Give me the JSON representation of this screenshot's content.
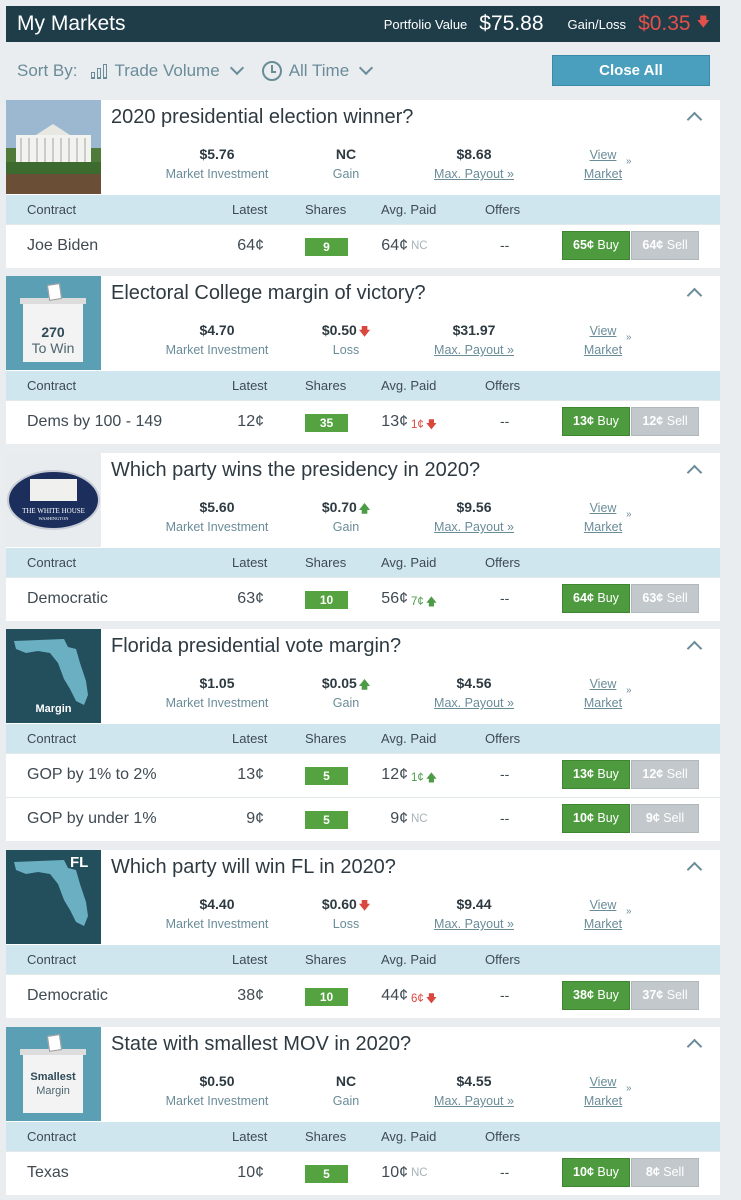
{
  "header": {
    "title": "My Markets",
    "portfolio_label": "Portfolio Value",
    "portfolio_value": "$75.88",
    "gainloss_label": "Gain/Loss",
    "gainloss_value": "$0.35",
    "gainloss_arrow": "down-arrow-icon"
  },
  "sortbar": {
    "label": "Sort By:",
    "sort_option": "Trade Volume",
    "time_option": "All Time",
    "close_all": "Close All"
  },
  "table_headers": {
    "contract": "Contract",
    "latest": "Latest",
    "shares": "Shares",
    "avg_paid": "Avg. Paid",
    "offers": "Offers"
  },
  "labels": {
    "market_investment": "Market Investment",
    "max_payout": "Max. Payout »",
    "view": "View",
    "market": "Market",
    "buy": "Buy",
    "sell": "Sell"
  },
  "markets": [
    {
      "title": "2020 presidential election winner?",
      "investment": "$5.76",
      "gain_value": "NC",
      "gain_label": "Gain",
      "gain_dir": "",
      "max_payout": "$8.68",
      "image": "white-house-photo",
      "rows": [
        {
          "contract": "Joe Biden",
          "latest": "64¢",
          "shares": "9",
          "avg": "64¢",
          "change": "NC",
          "change_dir": "nc",
          "offers": "--",
          "buy_price": "65¢",
          "sell_price": "64¢"
        }
      ]
    },
    {
      "title": "Electoral College margin of victory?",
      "investment": "$4.70",
      "gain_value": "$0.50",
      "gain_label": "Loss",
      "gain_dir": "down",
      "max_payout": "$31.97",
      "image": "ballot-box-270-to-win",
      "image_text_1": "270",
      "image_text_2": "To Win",
      "rows": [
        {
          "contract": "Dems by 100 - 149",
          "latest": "12¢",
          "shares": "35",
          "avg": "13¢",
          "change": "1¢",
          "change_dir": "down",
          "offers": "--",
          "buy_price": "13¢",
          "sell_price": "12¢"
        }
      ]
    },
    {
      "title": "Which party wins the presidency in 2020?",
      "investment": "$5.60",
      "gain_value": "$0.70",
      "gain_label": "Gain",
      "gain_dir": "up",
      "max_payout": "$9.56",
      "image": "white-house-seal",
      "image_text_1": "THE WHITE HOUSE",
      "image_text_2": "WASHINGTON",
      "rows": [
        {
          "contract": "Democratic",
          "latest": "63¢",
          "shares": "10",
          "avg": "56¢",
          "change": "7¢",
          "change_dir": "up",
          "offers": "--",
          "buy_price": "64¢",
          "sell_price": "63¢"
        }
      ]
    },
    {
      "title": "Florida presidential vote margin?",
      "investment": "$1.05",
      "gain_value": "$0.05",
      "gain_label": "Gain",
      "gain_dir": "up",
      "max_payout": "$4.56",
      "image": "florida-map-margin",
      "image_text_1": "Margin",
      "rows": [
        {
          "contract": "GOP by 1% to 2%",
          "latest": "13¢",
          "shares": "5",
          "avg": "12¢",
          "change": "1¢",
          "change_dir": "up",
          "offers": "--",
          "buy_price": "13¢",
          "sell_price": "12¢"
        },
        {
          "contract": "GOP by under 1%",
          "latest": "9¢",
          "shares": "5",
          "avg": "9¢",
          "change": "NC",
          "change_dir": "nc",
          "offers": "--",
          "buy_price": "10¢",
          "sell_price": "9¢"
        }
      ]
    },
    {
      "title": "Which party will win FL in 2020?",
      "investment": "$4.40",
      "gain_value": "$0.60",
      "gain_label": "Loss",
      "gain_dir": "down",
      "max_payout": "$9.44",
      "image": "florida-map-fl",
      "image_text_1": "FL",
      "rows": [
        {
          "contract": "Democratic",
          "latest": "38¢",
          "shares": "10",
          "avg": "44¢",
          "change": "6¢",
          "change_dir": "down",
          "offers": "--",
          "buy_price": "38¢",
          "sell_price": "37¢"
        }
      ]
    },
    {
      "title": "State with smallest MOV in 2020?",
      "investment": "$0.50",
      "gain_value": "NC",
      "gain_label": "Gain",
      "gain_dir": "",
      "max_payout": "$4.55",
      "image": "ballot-box-smallest-margin",
      "image_text_1": "Smallest",
      "image_text_2": "Margin",
      "rows": [
        {
          "contract": "Texas",
          "latest": "10¢",
          "shares": "5",
          "avg": "10¢",
          "change": "NC",
          "change_dir": "nc",
          "offers": "--",
          "buy_price": "10¢",
          "sell_price": "8¢"
        }
      ]
    }
  ]
}
